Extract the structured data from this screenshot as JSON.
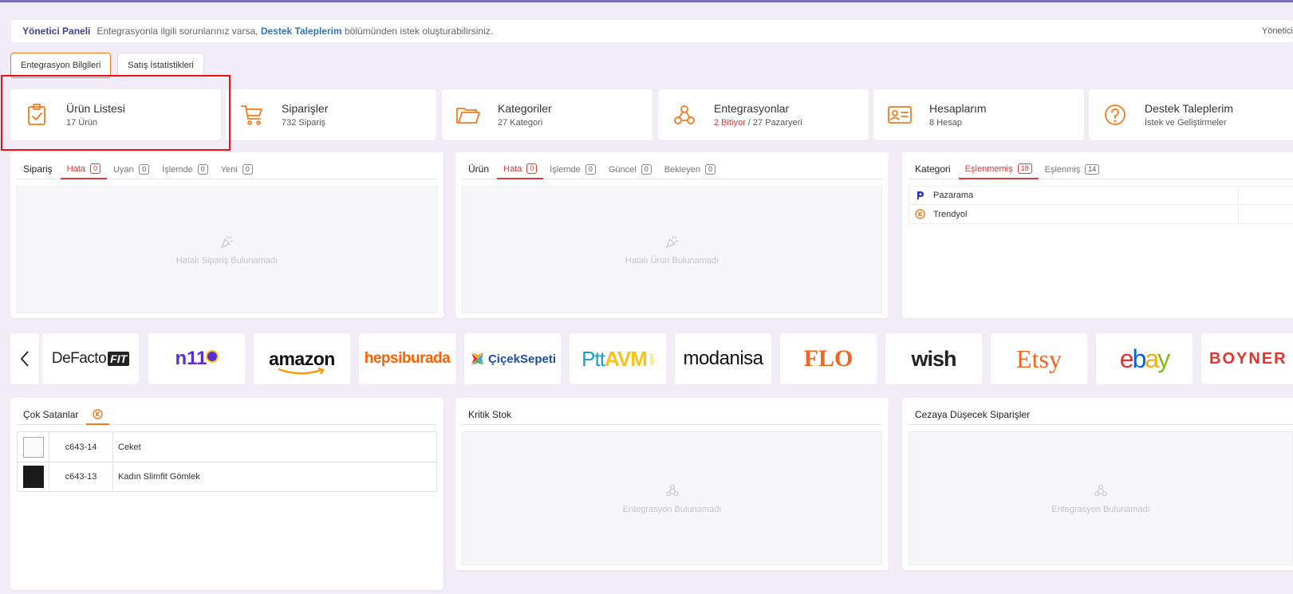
{
  "header": {
    "title": "Yönetici Paneli",
    "msg_before": "Entegrasyonla ilgili sorunlarınız varsa,",
    "msg_link": "Destek Taleplerim",
    "msg_after": "bölümünden istek oluşturabilirsiniz.",
    "right_label": "Yönetici"
  },
  "main_tabs": [
    "Entegrasyon Bilgileri",
    "Satış İstatistikleri"
  ],
  "cards": [
    {
      "title": "Ürün Listesi",
      "sub": "17 Ürün",
      "icon": "clipboard-check-icon"
    },
    {
      "title": "Siparişler",
      "sub": "732 Sipariş",
      "icon": "cart-icon"
    },
    {
      "title": "Kategoriler",
      "sub": "27 Kategori",
      "icon": "folder-icon"
    },
    {
      "title": "Entegrasyonlar",
      "sub_red": "2 Bitiyor",
      "sub_rest": " / 27 Pazaryeri",
      "icon": "webhook-icon"
    },
    {
      "title": "Hesaplarım",
      "sub": "8 Hesap",
      "icon": "id-card-icon"
    },
    {
      "title": "Destek Taleplerim",
      "sub": "İstek ve Geliştirmeler",
      "icon": "question-icon"
    }
  ],
  "order_panel": {
    "head": "Sipariş",
    "tabs": [
      {
        "label": "Hata",
        "count": "0"
      },
      {
        "label": "Uyarı",
        "count": "0"
      },
      {
        "label": "İşlemde",
        "count": "0"
      },
      {
        "label": "Yeni",
        "count": "0"
      }
    ],
    "empty": "Hatalı Sipariş Bulunamadı"
  },
  "product_panel": {
    "head": "Ürün",
    "tabs": [
      {
        "label": "Hata",
        "count": "0"
      },
      {
        "label": "İşlemde",
        "count": "0"
      },
      {
        "label": "Güncel",
        "count": "0"
      },
      {
        "label": "Bekleyen",
        "count": "0"
      }
    ],
    "empty": "Hatalı Ürün Bulunamadı"
  },
  "category_panel": {
    "head": "Kategori",
    "tabs": [
      {
        "label": "Eşlenmemiş",
        "count": "18"
      },
      {
        "label": "Eşlenmiş",
        "count": "14"
      }
    ],
    "rows": [
      "Pazarama",
      "Trendyol"
    ]
  },
  "marketplaces": [
    "DeFacto",
    "FIT",
    "n11",
    "amazon",
    "hepsiburada",
    "ÇiçekSepeti",
    "Ptt",
    "AVM",
    ".com",
    "modanisa",
    "FLO",
    "wish",
    "Etsy",
    "e",
    "b",
    "a",
    "y",
    "BOYNER"
  ],
  "best_sellers": {
    "head": "Çok Satanlar",
    "rows": [
      {
        "code": "c643-14",
        "name": "Ceket"
      },
      {
        "code": "c643-13",
        "name": "Kadın Slimfit Gömlek"
      }
    ]
  },
  "critical_stock": {
    "head": "Kritik Stok",
    "empty": "Entegrasyon Bulunamadı"
  },
  "penalty_orders": {
    "head": "Cezaya Düşecek Siparişler",
    "empty": "Entegrasyon Bulunamadı"
  },
  "colors": {
    "accent": "#f07b22",
    "error": "#e03a3a",
    "brand": "#3b3f9c",
    "link": "#2f74c0"
  }
}
